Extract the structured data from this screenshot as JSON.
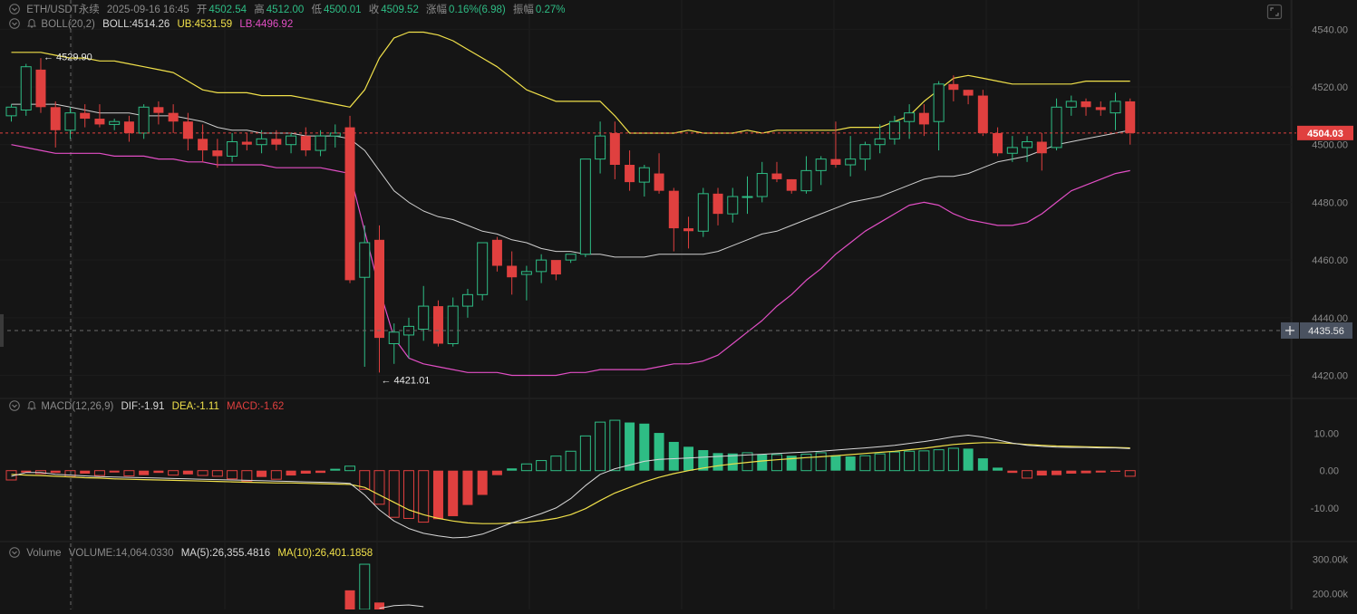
{
  "header": {
    "symbol": "ETH/USDT永续",
    "time": "2025-09-16 16:45",
    "open_label": "开",
    "open": "4502.54",
    "high_label": "高",
    "high": "4512.00",
    "low_label": "低",
    "low": "4500.01",
    "close_label": "收",
    "close": "4509.52",
    "change_label": "涨幅",
    "change": "0.16%(6.98)",
    "amp_label": "振幅",
    "amp": "0.27%"
  },
  "boll_legend": {
    "name": "BOLL(20,2)",
    "mid": "BOLL:4514.26",
    "ub": "UB:4531.59",
    "lb": "LB:4496.92"
  },
  "macd_legend": {
    "name": "MACD(12,26,9)",
    "dif": "DIF:-1.91",
    "dea": "DEA:-1.11",
    "macd": "MACD:-1.62"
  },
  "volume_legend": {
    "name": "Volume",
    "volume": "VOLUME:14,064.0330",
    "ma5": "MA(5):26,355.4816",
    "ma10": "MA(10):26,401.1858"
  },
  "colors": {
    "up": "#2ebd85",
    "down": "#e0403f",
    "ub": "#f0e04a",
    "mid": "#cfcfcf",
    "lb": "#e14ec4",
    "dea": "#f0e04a",
    "dif": "#d8d8d8"
  },
  "chart_data": [
    {
      "type": "candlestick",
      "name": "price",
      "ylim": [
        4412,
        4547
      ],
      "y_ticks": [
        "4540.00",
        "4520.00",
        "4500.00",
        "4480.00",
        "4460.00",
        "4440.00",
        "4420.00"
      ],
      "y_tick_values": [
        4540,
        4520,
        4500,
        4480,
        4460,
        4440,
        4420
      ],
      "last_price_label": "4504.03",
      "last_price": 4504.03,
      "crosshair_label": "4435.56",
      "crosshair_price": 4435.56,
      "max_annotation": "← 4529.90",
      "max_annotation_index": 2,
      "max_annotation_price": 4529.9,
      "min_annotation": "← 4421.01",
      "min_annotation_index": 25,
      "min_annotation_price": 4421.01,
      "candles": [
        [
          4510,
          4514,
          4508,
          4513
        ],
        [
          4512,
          4528,
          4510,
          4527
        ],
        [
          4526,
          4530,
          4511,
          4513
        ],
        [
          4513,
          4515,
          4499,
          4505
        ],
        [
          4505,
          4513,
          4502,
          4511
        ],
        [
          4511,
          4514,
          4506,
          4509
        ],
        [
          4509,
          4514,
          4506,
          4507
        ],
        [
          4507,
          4509,
          4505,
          4508
        ],
        [
          4508,
          4510,
          4501,
          4504
        ],
        [
          4504,
          4514,
          4502,
          4513
        ],
        [
          4513,
          4515,
          4507,
          4511
        ],
        [
          4511,
          4514,
          4504,
          4508
        ],
        [
          4508,
          4511,
          4498,
          4502
        ],
        [
          4502,
          4507,
          4494,
          4498
        ],
        [
          4498,
          4502,
          4492,
          4496
        ],
        [
          4496,
          4504,
          4494,
          4501
        ],
        [
          4501,
          4504,
          4498,
          4500
        ],
        [
          4500,
          4505,
          4497,
          4502
        ],
        [
          4502,
          4505,
          4498,
          4500
        ],
        [
          4500,
          4504,
          4497,
          4503
        ],
        [
          4503,
          4506,
          4496,
          4498
        ],
        [
          4498,
          4505,
          4496,
          4503
        ],
        [
          4503,
          4507,
          4499,
          4504
        ],
        [
          4506,
          4510,
          4452,
          4453
        ],
        [
          4454,
          4472,
          4423,
          4466
        ],
        [
          4467,
          4472,
          4421,
          4433
        ],
        [
          4431,
          4438,
          4424,
          4435
        ],
        [
          4434,
          4440,
          4426,
          4437
        ],
        [
          4436,
          4451,
          4432,
          4444
        ],
        [
          4444,
          4446,
          4430,
          4431
        ],
        [
          4431,
          4447,
          4430,
          4444
        ],
        [
          4444,
          4450,
          4440,
          4448
        ],
        [
          4448,
          4462,
          4446,
          4466
        ],
        [
          4467,
          4468,
          4456,
          4458
        ],
        [
          4458,
          4463,
          4448,
          4454
        ],
        [
          4455,
          4458,
          4446,
          4456
        ],
        [
          4456,
          4462,
          4452,
          4460
        ],
        [
          4460,
          4458,
          4453,
          4455
        ],
        [
          4460,
          4462,
          4459,
          4462
        ],
        [
          4462,
          4492,
          4461,
          4495
        ],
        [
          4495,
          4508,
          4490,
          4503
        ],
        [
          4504,
          4508,
          4488,
          4493
        ],
        [
          4493,
          4498,
          4484,
          4487
        ],
        [
          4487,
          4493,
          4482,
          4492
        ],
        [
          4490,
          4497,
          4483,
          4484
        ],
        [
          4484,
          4485,
          4463,
          4471
        ],
        [
          4471,
          4475,
          4464,
          4470
        ],
        [
          4470,
          4485,
          4468,
          4483
        ],
        [
          4483,
          4485,
          4472,
          4476
        ],
        [
          4476,
          4485,
          4473,
          4482
        ],
        [
          4482,
          4489,
          4476,
          4482
        ],
        [
          4482,
          4494,
          4480,
          4490
        ],
        [
          4490,
          4494,
          4487,
          4488
        ],
        [
          4488,
          4488,
          4483,
          4484
        ],
        [
          4484,
          4496,
          4483,
          4491
        ],
        [
          4491,
          4496,
          4486,
          4495
        ],
        [
          4495,
          4508,
          4492,
          4493
        ],
        [
          4493,
          4503,
          4489,
          4495
        ],
        [
          4495,
          4501,
          4491,
          4500
        ],
        [
          4500,
          4507,
          4497,
          4502
        ],
        [
          4502,
          4510,
          4500,
          4508
        ],
        [
          4508,
          4514,
          4502,
          4511
        ],
        [
          4511,
          4514,
          4503,
          4507
        ],
        [
          4508,
          4522,
          4498,
          4521
        ],
        [
          4521,
          4524,
          4515,
          4519
        ],
        [
          4519,
          4519,
          4514,
          4517
        ],
        [
          4517,
          4519,
          4503,
          4504
        ],
        [
          4504,
          4506,
          4496,
          4497
        ],
        [
          4497,
          4503,
          4494,
          4499
        ],
        [
          4499,
          4503,
          4494,
          4501
        ],
        [
          4501,
          4504,
          4491,
          4497
        ],
        [
          4499,
          4516,
          4498,
          4513
        ],
        [
          4513,
          4517,
          4510,
          4515
        ],
        [
          4515,
          4516,
          4510,
          4513
        ],
        [
          4513,
          4515,
          4510,
          4512
        ],
        [
          4511,
          4518,
          4505,
          4515
        ],
        [
          4515,
          4516,
          4500,
          4504
        ]
      ],
      "boll_ub": [
        4532,
        4532,
        4532,
        4531,
        4530,
        4530,
        4529,
        4529,
        4528,
        4527,
        4526,
        4525,
        4522,
        4519,
        4518,
        4518,
        4518,
        4517,
        4517,
        4517,
        4516,
        4515,
        4514,
        4513,
        4519,
        4530,
        4537,
        4539,
        4539,
        4538,
        4536,
        4533,
        4530,
        4527,
        4523,
        4519,
        4517,
        4515,
        4515,
        4515,
        4515,
        4510,
        4504,
        4504,
        4504,
        4504,
        4505,
        4504,
        4504,
        4504,
        4505,
        4504,
        4505,
        4505,
        4505,
        4505,
        4505,
        4506,
        4506,
        4506,
        4508,
        4510,
        4515,
        4519,
        4523,
        4524,
        4523,
        4522,
        4521,
        4521,
        4521,
        4521,
        4521,
        4522,
        4522,
        4522,
        4522
      ],
      "boll_mid": [
        4514,
        4514,
        4514,
        4514,
        4513,
        4512,
        4511,
        4511,
        4511,
        4510,
        4510,
        4510,
        4509,
        4508,
        4506,
        4505,
        4505,
        4504,
        4504,
        4504,
        4503,
        4503,
        4503,
        4502,
        4498,
        4491,
        4484,
        4480,
        4477,
        4475,
        4474,
        4472,
        4470,
        4469,
        4467,
        4466,
        4464,
        4463,
        4463,
        4462,
        4462,
        4461,
        4461,
        4461,
        4462,
        4462,
        4462,
        4462,
        4463,
        4465,
        4467,
        4469,
        4470,
        4472,
        4474,
        4476,
        4478,
        4480,
        4481,
        4482,
        4484,
        4486,
        4488,
        4489,
        4489,
        4490,
        4492,
        4494,
        4495,
        4496,
        4498,
        4500,
        4501,
        4502,
        4503,
        4504,
        4505
      ],
      "boll_lb": [
        4500,
        4499,
        4498,
        4497,
        4497,
        4497,
        4497,
        4496,
        4496,
        4496,
        4495,
        4495,
        4494,
        4494,
        4493,
        4493,
        4493,
        4493,
        4492,
        4492,
        4492,
        4492,
        4491,
        4490,
        4470,
        4450,
        4433,
        4426,
        4424,
        4423,
        4422,
        4421,
        4421,
        4421,
        4420,
        4420,
        4420,
        4420,
        4421,
        4421,
        4422,
        4422,
        4422,
        4422,
        4423,
        4424,
        4424,
        4425,
        4427,
        4431,
        4435,
        4439,
        4444,
        4448,
        4453,
        4457,
        4462,
        4466,
        4470,
        4473,
        4476,
        4479,
        4480,
        4479,
        4476,
        4474,
        4473,
        4472,
        4472,
        4473,
        4476,
        4480,
        4484,
        4486,
        4488,
        4490,
        4491
      ]
    },
    {
      "type": "macd",
      "name": "MACD",
      "ylim": [
        -19,
        14
      ],
      "y_ticks": [
        "10.00",
        "0.00",
        "-10.00"
      ],
      "y_tick_values": [
        10,
        0,
        -10
      ],
      "hist": [
        -2.5,
        -0.5,
        -0.8,
        -0.6,
        -1.6,
        -0.8,
        -1.3,
        -0.5,
        -1.4,
        -1.2,
        -0.6,
        -1.2,
        -1.0,
        -1.3,
        -1.5,
        -2.2,
        -2.8,
        -1.7,
        -2.3,
        -1.3,
        -0.8,
        -0.6,
        0.5,
        1.2,
        -5.0,
        -9.0,
        -12.5,
        -12.8,
        -13.8,
        -13.0,
        -12.2,
        -9.2,
        -6.5,
        -1.2,
        0.6,
        1.8,
        2.7,
        3.9,
        5.2,
        9.3,
        13.0,
        13.5,
        12.9,
        12.6,
        10.1,
        7.7,
        6.4,
        5.5,
        4.7,
        4.6,
        4.8,
        4.3,
        4.3,
        4.0,
        4.4,
        4.8,
        4.1,
        3.8,
        4.0,
        4.5,
        5.0,
        5.2,
        5.3,
        5.6,
        6.0,
        5.9,
        3.3,
        0.8,
        -0.6,
        -2.0,
        -1.3,
        -1.2,
        -0.8,
        -0.7,
        -0.5,
        -0.3,
        -1.5
      ],
      "dif": [
        -1.5,
        -0.5,
        -0.5,
        -1.0,
        -1.2,
        -1.4,
        -1.6,
        -1.7,
        -1.8,
        -1.9,
        -2.0,
        -2.1,
        -2.2,
        -2.3,
        -2.4,
        -2.5,
        -2.6,
        -2.7,
        -2.8,
        -2.9,
        -3.0,
        -3.1,
        -3.2,
        -3.4,
        -6.5,
        -10.5,
        -13.5,
        -15.5,
        -16.8,
        -17.5,
        -18.0,
        -17.8,
        -17.0,
        -15.5,
        -14.0,
        -12.8,
        -11.5,
        -10.0,
        -7.5,
        -4.0,
        -1.0,
        0.5,
        1.5,
        2.5,
        3.0,
        3.2,
        3.4,
        3.6,
        3.8,
        4.0,
        4.2,
        4.4,
        4.6,
        4.8,
        5.0,
        5.2,
        5.5,
        5.8,
        6.1,
        6.4,
        6.8,
        7.3,
        7.8,
        8.4,
        9.1,
        9.5,
        9.0,
        8.2,
        7.4,
        6.8,
        6.5,
        6.3,
        6.2,
        6.2,
        6.1,
        6.1,
        5.9
      ],
      "dea": [
        -1.0,
        -1.2,
        -1.3,
        -1.5,
        -1.7,
        -1.9,
        -2.0,
        -2.2,
        -2.3,
        -2.4,
        -2.5,
        -2.6,
        -2.7,
        -2.8,
        -2.9,
        -3.0,
        -3.1,
        -3.2,
        -3.3,
        -3.3,
        -3.4,
        -3.5,
        -3.6,
        -3.7,
        -4.5,
        -6.5,
        -8.5,
        -10.5,
        -11.8,
        -12.8,
        -13.5,
        -14.0,
        -14.2,
        -14.2,
        -14.0,
        -13.8,
        -13.4,
        -12.8,
        -11.8,
        -10.2,
        -8.0,
        -6.0,
        -4.5,
        -3.0,
        -1.8,
        -0.8,
        0.0,
        0.7,
        1.3,
        1.8,
        2.2,
        2.6,
        2.9,
        3.2,
        3.5,
        3.7,
        4.0,
        4.3,
        4.6,
        4.9,
        5.2,
        5.6,
        6.0,
        6.5,
        7.0,
        7.3,
        7.5,
        7.5,
        7.3,
        7.0,
        6.8,
        6.6,
        6.5,
        6.4,
        6.3,
        6.2,
        6.1
      ]
    },
    {
      "type": "bar",
      "name": "Volume",
      "ylim": [
        155000,
        345000
      ],
      "y_ticks": [
        "300.00k",
        "200.00k"
      ],
      "y_tick_values": [
        300000,
        200000
      ],
      "visible_bars": [
        {
          "index": 23,
          "value": 210000,
          "dir": "down"
        },
        {
          "index": 24,
          "value": 285000,
          "dir": "up"
        },
        {
          "index": 25,
          "value": 175000,
          "dir": "down"
        }
      ],
      "ma_line": [
        [
          25,
          158000
        ],
        [
          26,
          166000
        ],
        [
          27,
          168000
        ],
        [
          28,
          163000
        ]
      ]
    }
  ]
}
